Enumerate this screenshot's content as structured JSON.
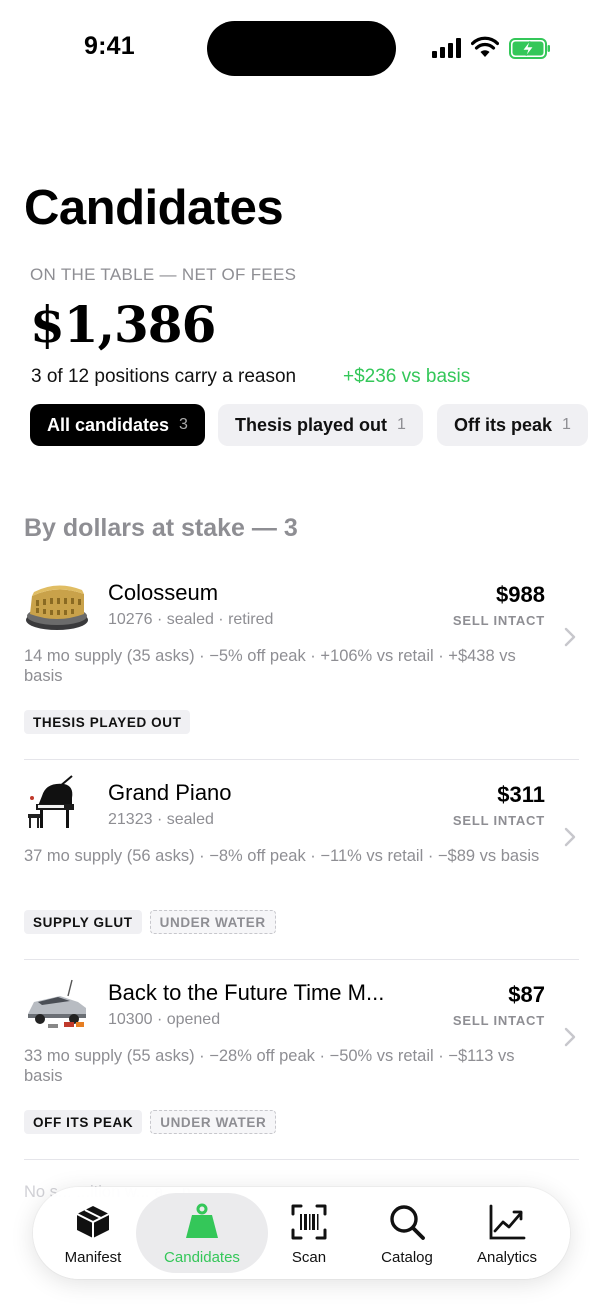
{
  "status_bar": {
    "time": "9:41"
  },
  "header": {
    "title": "Candidates",
    "eyebrow": "ON THE TABLE — NET OF FEES",
    "amount": "$1,386",
    "reason_line": "3 of 12 positions carry a reason",
    "vs_basis": "+$236 vs basis"
  },
  "filters": [
    {
      "label": "All candidates",
      "count": "3",
      "active": true
    },
    {
      "label": "Thesis played out",
      "count": "1",
      "active": false
    },
    {
      "label": "Off its peak",
      "count": "1",
      "active": false
    }
  ],
  "section_heading": "By dollars at stake — 3",
  "items": [
    {
      "name": "Colosseum",
      "meta": "10276 · sealed · retired",
      "price": "$988",
      "action": "SELL INTACT",
      "stats": "14 mo supply (35 asks) · −5% off peak · +106% vs retail · +$438 vs basis",
      "tags": [
        {
          "label": "THESIS PLAYED OUT",
          "style": "solid"
        }
      ],
      "thumb_icon": "colosseum-thumbnail"
    },
    {
      "name": "Grand Piano",
      "meta": "21323 · sealed",
      "price": "$311",
      "action": "SELL INTACT",
      "stats": "37 mo supply (56 asks) · −8% off peak · −11% vs retail · −$89 vs basis",
      "tags": [
        {
          "label": "SUPPLY GLUT",
          "style": "solid"
        },
        {
          "label": "UNDER WATER",
          "style": "outline"
        }
      ],
      "thumb_icon": "grand-piano-thumbnail"
    },
    {
      "name": "Back to the Future Time M...",
      "meta": "10300 · opened",
      "price": "$87",
      "action": "SELL INTACT",
      "stats": "33 mo supply (55 asks) · −28% off peak · −50% vs retail · −$113 vs basis",
      "tags": [
        {
          "label": "OFF ITS PEAK",
          "style": "solid"
        },
        {
          "label": "UNDER WATER",
          "style": "outline"
        }
      ],
      "thumb_icon": "delorean-thumbnail"
    }
  ],
  "footnote": "No s... ...ition w... a... n...",
  "tabbar": [
    {
      "label": "Manifest",
      "icon": "box-icon",
      "active": false
    },
    {
      "label": "Candidates",
      "icon": "weight-icon",
      "active": true
    },
    {
      "label": "Scan",
      "icon": "barcode-scan-icon",
      "active": false
    },
    {
      "label": "Catalog",
      "icon": "search-icon",
      "active": false
    },
    {
      "label": "Analytics",
      "icon": "chart-line-icon",
      "active": false
    }
  ],
  "colors": {
    "accent_green": "#34c759",
    "secondary_text": "#8e8e93",
    "chip_bg": "#f0f0f3"
  }
}
